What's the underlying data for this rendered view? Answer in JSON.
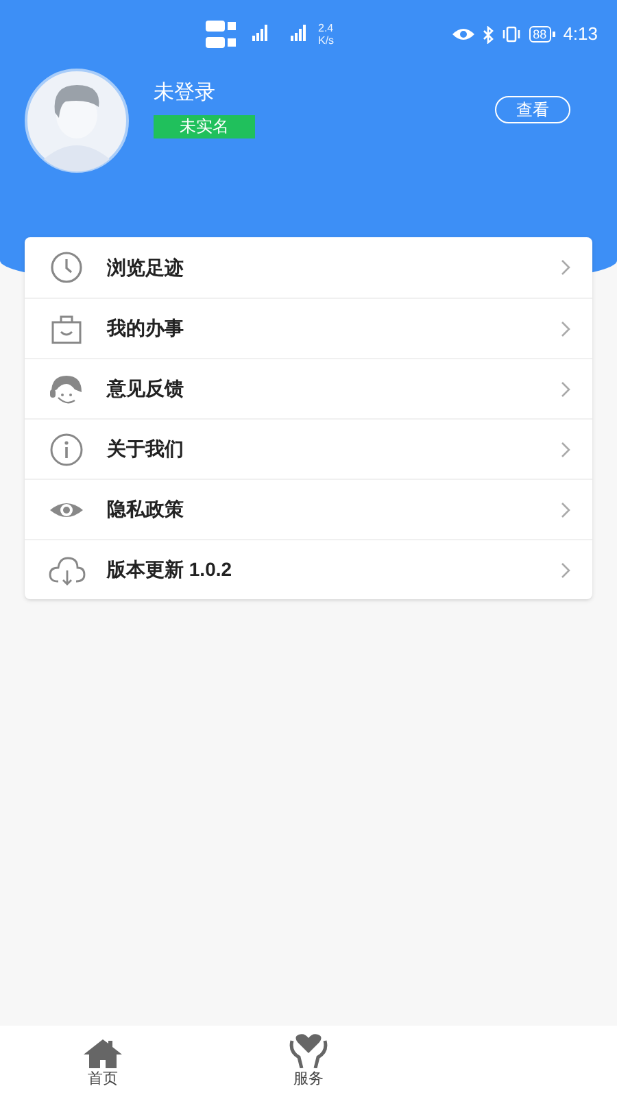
{
  "status_bar": {
    "speed": "2.4",
    "speed_unit": "K/s",
    "battery": "88",
    "time": "4:13"
  },
  "profile": {
    "name": "未登录",
    "badge": "未实名",
    "view_button": "查看"
  },
  "menu": [
    {
      "kind": "clock",
      "label": "浏览足迹"
    },
    {
      "kind": "bag",
      "label": "我的办事"
    },
    {
      "kind": "headset",
      "label": "意见反馈"
    },
    {
      "kind": "info",
      "label": "关于我们"
    },
    {
      "kind": "eye",
      "label": "隐私政策"
    },
    {
      "kind": "cloud",
      "label": "版本更新 1.0.2"
    }
  ],
  "tab_bar": [
    {
      "kind": "home",
      "label": "首页"
    },
    {
      "kind": "heart",
      "label": "服务"
    }
  ]
}
